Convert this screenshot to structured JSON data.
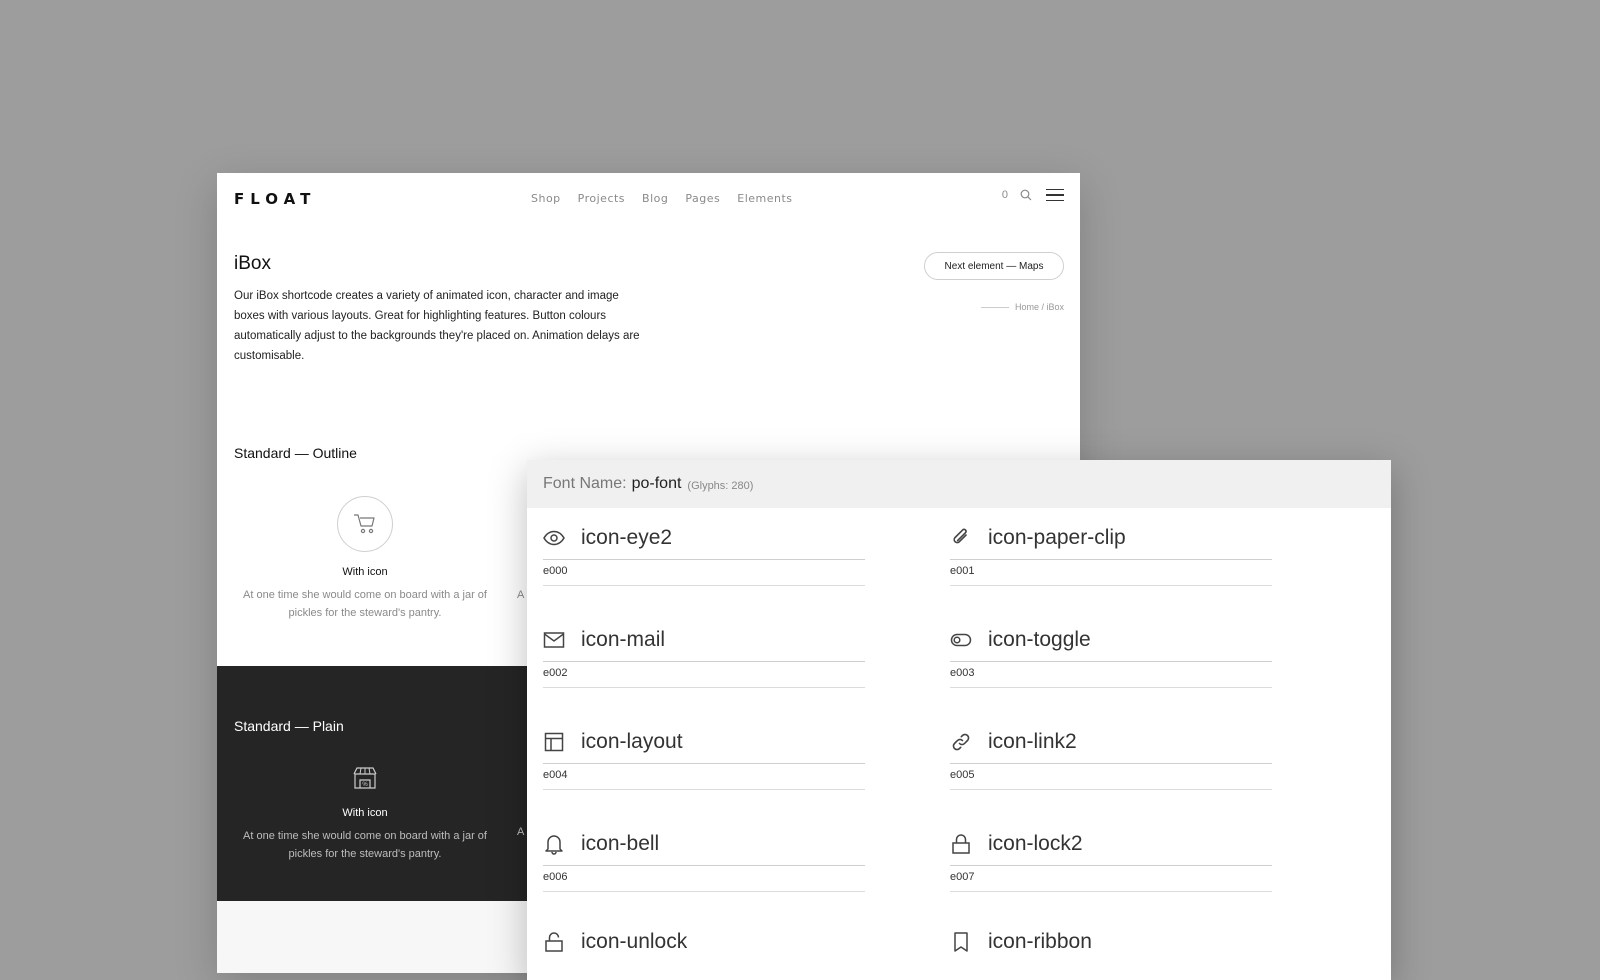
{
  "site": {
    "logo": "FLOAT",
    "nav": [
      "Shop",
      "Projects",
      "Blog",
      "Pages",
      "Elements"
    ],
    "cart_count": "0",
    "page_title": "iBox",
    "intro": "Our iBox shortcode creates a variety of animated icon, character and image boxes with various layouts. Great for highlighting features. Button colours automatically adjust to the backgrounds they're placed on. Animation delays are customisable.",
    "next_button": "Next element — Maps",
    "breadcrumb": {
      "home": "Home",
      "separator": " / ",
      "current": "iBox"
    },
    "section_outline": {
      "title": "Standard — Outline",
      "box_title": "With icon",
      "box_text": "At one time she would come on board with a jar of pickles for the steward's pantry.",
      "icon": "cart-icon",
      "cut_text": "A"
    },
    "section_plain": {
      "title": "Standard — Plain",
      "box_title": "With icon",
      "box_text": "At one time she would come on board with a jar of pickles for the steward's pantry.",
      "icon": "shop-icon",
      "cut_text": "A"
    },
    "colors": {
      "dark_band": "#252525",
      "text": "#111111",
      "muted": "#8a8a8a"
    }
  },
  "font_panel": {
    "label": "Font Name:",
    "font_name": "po-font",
    "glyph_count": "(Glyphs: 280)",
    "glyphs": [
      {
        "name": "icon-eye2",
        "code": "e000",
        "icon": "eye-icon"
      },
      {
        "name": "icon-paper-clip",
        "code": "e001",
        "icon": "paper-clip-icon"
      },
      {
        "name": "icon-mail",
        "code": "e002",
        "icon": "mail-icon"
      },
      {
        "name": "icon-toggle",
        "code": "e003",
        "icon": "toggle-icon"
      },
      {
        "name": "icon-layout",
        "code": "e004",
        "icon": "layout-icon"
      },
      {
        "name": "icon-link2",
        "code": "e005",
        "icon": "link-icon"
      },
      {
        "name": "icon-bell",
        "code": "e006",
        "icon": "bell-icon"
      },
      {
        "name": "icon-lock2",
        "code": "e007",
        "icon": "lock-icon"
      },
      {
        "name": "icon-unlock",
        "code": "",
        "icon": "unlock-icon"
      },
      {
        "name": "icon-ribbon",
        "code": "",
        "icon": "ribbon-icon"
      }
    ]
  }
}
